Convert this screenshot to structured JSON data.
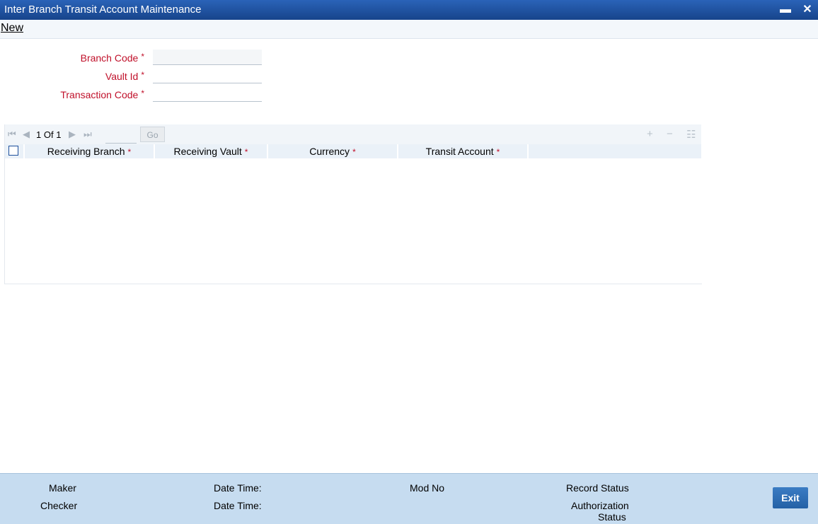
{
  "window": {
    "title": "Inter Branch Transit Account Maintenance",
    "minimize": "▬",
    "close": "✕"
  },
  "menu": {
    "new_label": "New"
  },
  "form": {
    "branch_code_label": "Branch Code",
    "vault_id_label": "Vault Id",
    "transaction_code_label": "Transaction Code",
    "required_mark": "*",
    "branch_code_value": "",
    "vault_id_value": "",
    "transaction_code_value": ""
  },
  "grid": {
    "page_current": "1",
    "page_of": "Of",
    "page_total": "1",
    "go_label": "Go",
    "columns": [
      "Receiving Branch",
      "Receiving Vault",
      "Currency",
      "Transit Account"
    ],
    "required_mark": "*",
    "rows": []
  },
  "footer": {
    "maker_label": "Maker",
    "checker_label": "Checker",
    "date_time_label_1": "Date Time:",
    "date_time_label_2": "Date Time:",
    "mod_no_label": "Mod No",
    "record_status_label": "Record Status",
    "authorization_label": "Authorization",
    "status_label": "Status",
    "exit_label": "Exit"
  },
  "colors": {
    "title_bar": "#1d4f9c",
    "required": "#c0102a",
    "footer": "#c6dcf0",
    "exit_button": "#2b6cb0"
  }
}
